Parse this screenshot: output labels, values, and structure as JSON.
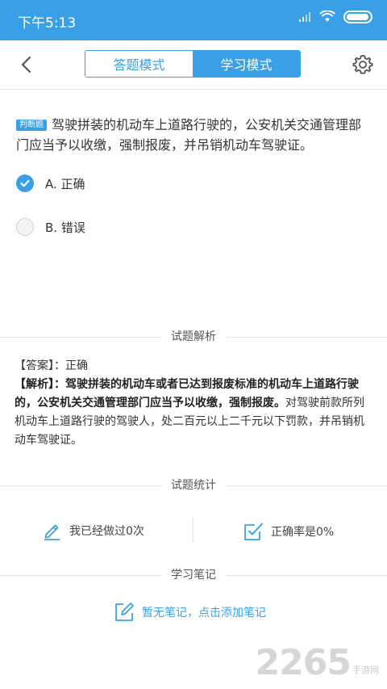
{
  "status_bar": {
    "time": "下午5:13"
  },
  "nav": {
    "tabs": [
      {
        "label": "答题模式",
        "active": false
      },
      {
        "label": "学习模式",
        "active": true
      }
    ]
  },
  "question": {
    "tag": "判断题",
    "text": "驾驶拼装的机动车上道路行驶的，公安机关交通管理部门应当予以收缴，强制报废，并吊销机动车驾驶证。",
    "options": [
      {
        "label": "A. 正确",
        "selected": true
      },
      {
        "label": "B. 错误",
        "selected": false
      }
    ]
  },
  "analysis_section": {
    "title": "试题解析",
    "answer_prefix": "【答案】：",
    "answer_value": "正确",
    "analysis_prefix": "【解析】：",
    "analysis_bold": "驾驶拼装的机动车或者已达到报废标准的机动车上道路行驶的，公安机关交通管理部门应当予以收缴，强制报废。",
    "analysis_rest": "对驾驶前款所列机动车上道路行驶的驾驶人，处二百元以上二千元以下罚款，并吊销机动车驾驶证。"
  },
  "stats_section": {
    "title": "试题统计",
    "done_text": "我已经做过0次",
    "accuracy_text": "正确率是0%"
  },
  "notes_section": {
    "title": "学习笔记",
    "empty_action": "暂无笔记，点击添加笔记"
  },
  "watermark": {
    "number": "2265",
    "site": "手游网"
  },
  "colors": {
    "primary": "#3aa0e6",
    "text": "#333333",
    "divider": "#e6e6e6"
  }
}
